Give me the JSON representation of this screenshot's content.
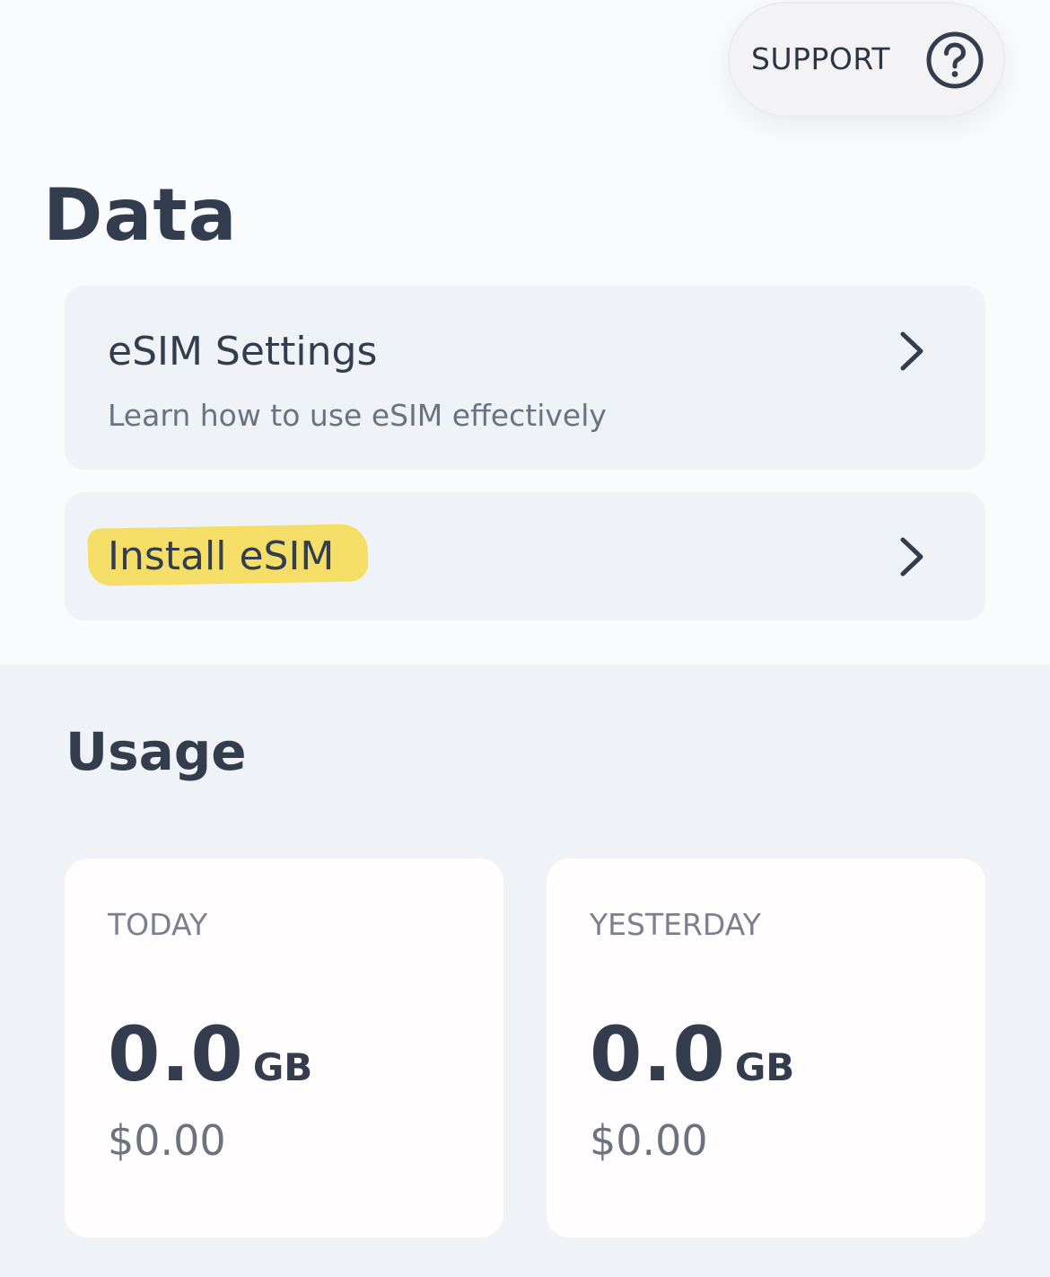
{
  "header": {
    "support_label": "SUPPORT",
    "support_icon": "question-circle-icon"
  },
  "page": {
    "title": "Data"
  },
  "rows": {
    "esim_settings": {
      "title": "eSIM Settings",
      "subtitle": "Learn how to use eSIM effectively",
      "icon": "chevron-right-icon"
    },
    "install_esim": {
      "title": "Install eSIM",
      "icon": "chevron-right-icon",
      "highlight_color": "#f6db4f"
    }
  },
  "usage": {
    "title": "Usage",
    "cards": [
      {
        "period": "TODAY",
        "amount": "0.0",
        "unit": "GB",
        "cost": "$0.00"
      },
      {
        "period": "YESTERDAY",
        "amount": "0.0",
        "unit": "GB",
        "cost": "$0.00"
      }
    ]
  },
  "colors": {
    "text_primary": "#333d4e",
    "text_secondary": "#6b7280",
    "card_background": "#eff2f6",
    "page_background": "#fafbfd",
    "highlight": "#f6db4f"
  }
}
